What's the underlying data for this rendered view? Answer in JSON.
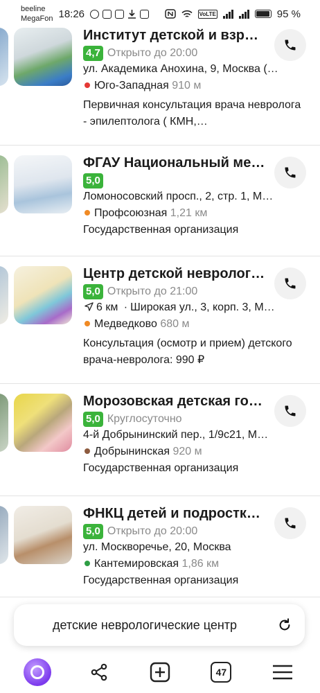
{
  "status_bar": {
    "carrier1": "beeline",
    "carrier2": "MegaFon",
    "time": "18:26",
    "volte": "VoLTE",
    "battery": "95 %"
  },
  "results": [
    {
      "name": "Институт детской и взр…",
      "rating": "4,7",
      "hours": "Открыто до 20:00",
      "address": "ул. Академика Анохина, 9, Москва (…",
      "metro": "Юго-Западная",
      "metro_color": "#e53935",
      "distance": "910 м",
      "description": "Первичная консультация врача невролога - эпилептолога ( КМН,…"
    },
    {
      "name": "ФГАУ Национальный ме…",
      "rating": "5,0",
      "hours": "",
      "address": "Ломоносовский просп., 2, стр. 1, М…",
      "metro": "Профсоюзная",
      "metro_color": "#f08a24",
      "distance": "1,21 км",
      "description": "Государственная организация"
    },
    {
      "name": "Центр детской невролог…",
      "rating": "5,0",
      "hours": "Открыто до 21:00",
      "route_distance": "6 км",
      "address": "Широкая ул., 3, корп. 3, М…",
      "metro": "Медведково",
      "metro_color": "#f08a24",
      "distance": "680 м",
      "description": "Консультация (осмотр и прием) детского врача-невролога: 990 ₽"
    },
    {
      "name": "Морозовская детская го…",
      "rating": "5,0",
      "hours": "Круглосуточно",
      "address": "4-й Добрынинский пер., 1/9с21, М…",
      "metro": "Добрынинская",
      "metro_color": "#8d5b3f",
      "distance": "920 м",
      "description": "Государственная организация"
    },
    {
      "name": "ФНКЦ детей и подростк…",
      "rating": "5,0",
      "hours": "Открыто до 20:00",
      "address": "ул. Москворечье, 20, Москва",
      "metro": "Кантемировская",
      "metro_color": "#2e9e44",
      "distance": "1,86 км",
      "description": "Государственная организация"
    }
  ],
  "search": {
    "query": "детские неврологические центр"
  },
  "bottom_nav": {
    "tabs_count": "47"
  },
  "colors": {
    "rating_green": "#3bb33b",
    "alice_purple": "#7c3aed"
  }
}
